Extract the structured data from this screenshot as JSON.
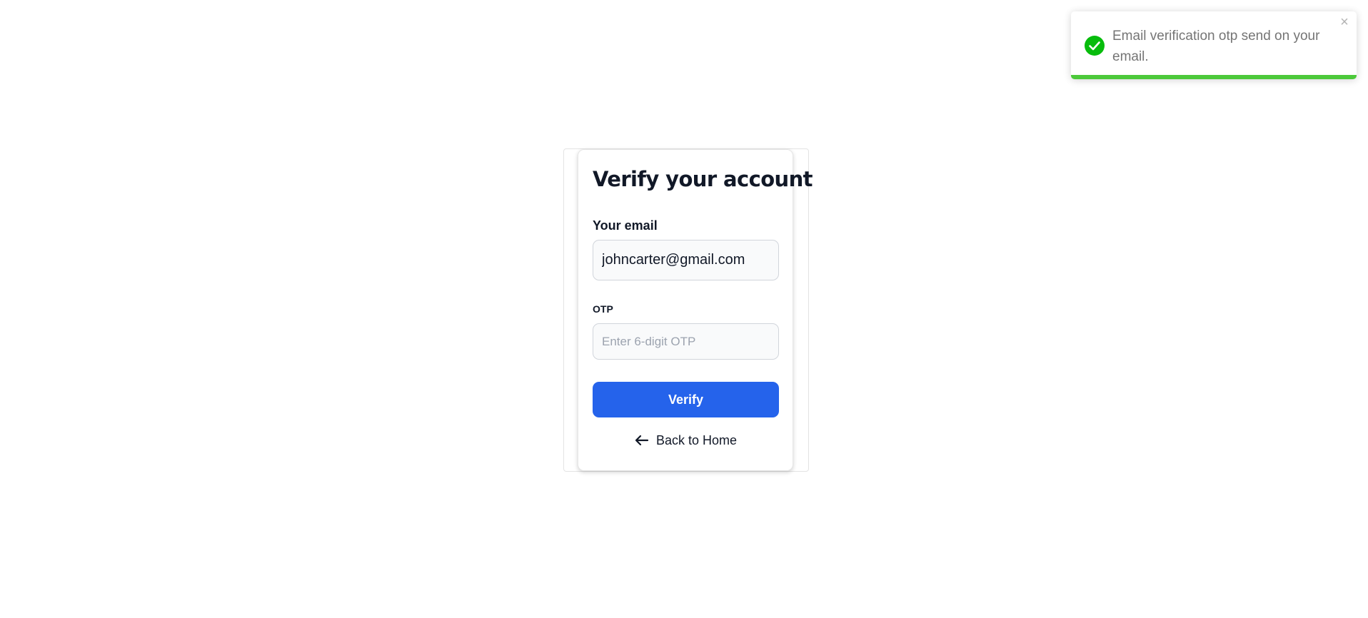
{
  "card": {
    "title": "Verify your account",
    "email_label": "Your email",
    "email_value": "johncarter@gmail.com",
    "otp_label": "OTP",
    "otp_placeholder": "Enter 6-digit OTP",
    "otp_value": "",
    "verify_label": "Verify",
    "back_label": "Back to Home",
    "back_icon": "arrow-left-icon"
  },
  "toast": {
    "message": "Email verification otp send on your email.",
    "status_icon": "check-circle-icon",
    "close_icon": "close-icon",
    "close_glyph": "×",
    "progress_fraction": 1.0,
    "success_color": "#07bc0c",
    "progress_color": "#4cc93a"
  },
  "colors": {
    "primary_button": "#2563eb",
    "text_dark": "#111827"
  }
}
